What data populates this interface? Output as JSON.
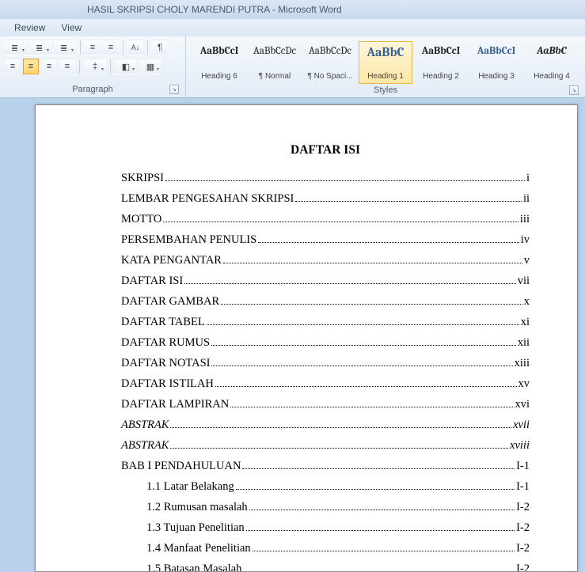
{
  "titlebar": {
    "text": "HASIL SKRIPSI CHOLY MARENDI PUTRA  -  Microsoft Word"
  },
  "menu": {
    "review": "Review",
    "view": "View"
  },
  "ribbon": {
    "paragraph_label": "Paragraph",
    "styles_label": "Styles",
    "sort_label": "A→Z",
    "pilcrow": "¶"
  },
  "styles": [
    {
      "preview": "AaBbCcI",
      "label": "Heading 6",
      "cls": "bold"
    },
    {
      "preview": "AaBbCcDc",
      "label": "¶ Normal",
      "cls": ""
    },
    {
      "preview": "AaBbCcDc",
      "label": "¶ No Spaci...",
      "cls": ""
    },
    {
      "preview": "AaBbC",
      "label": "Heading 1",
      "cls": "heading1",
      "selected": true
    },
    {
      "preview": "AaBbCcI",
      "label": "Heading 2",
      "cls": "bold"
    },
    {
      "preview": "AaBbCcI",
      "label": "Heading 3",
      "cls": "blue bold"
    },
    {
      "preview": "AaBbC",
      "label": "Heading 4",
      "cls": "italic bold"
    }
  ],
  "document": {
    "heading": "DAFTAR ISI",
    "toc": [
      {
        "text": "SKRIPSI",
        "page": "i"
      },
      {
        "text": "LEMBAR PENGESAHAN SKRIPSI",
        "page": "ii"
      },
      {
        "text": "MOTTO",
        "page": "iii"
      },
      {
        "text": "PERSEMBAHAN PENULIS",
        "page": "iv"
      },
      {
        "text": "KATA PENGANTAR",
        "page": "v"
      },
      {
        "text": "DAFTAR ISI",
        "page": "vii"
      },
      {
        "text": "DAFTAR GAMBAR",
        "page": "x"
      },
      {
        "text": "DAFTAR TABEL",
        "page": "xi"
      },
      {
        "text": "DAFTAR RUMUS",
        "page": "xii"
      },
      {
        "text": "DAFTAR NOTASI",
        "page": "xiii"
      },
      {
        "text": "DAFTAR ISTILAH",
        "page": "xv"
      },
      {
        "text": "DAFTAR LAMPIRAN",
        "page": "xvi"
      },
      {
        "text": "ABSTRAK",
        "page": "xvii",
        "italic": true
      },
      {
        "text": "ABSTRAK",
        "page": "xviii",
        "italic": true
      },
      {
        "text": "BAB I PENDAHULUAN",
        "page": "I-1"
      },
      {
        "text": "1.1  Latar Belakang",
        "page": "I-1",
        "indent": true
      },
      {
        "text": "1.2  Rumusan masalah",
        "page": "I-2",
        "indent": true
      },
      {
        "text": "1.3  Tujuan Penelitian",
        "page": "I-2",
        "indent": true
      },
      {
        "text": "1.4  Manfaat Penelitian",
        "page": "I-2",
        "indent": true
      },
      {
        "text": "1.5  Batasan Masalah",
        "page": "I-2",
        "indent": true
      }
    ]
  }
}
